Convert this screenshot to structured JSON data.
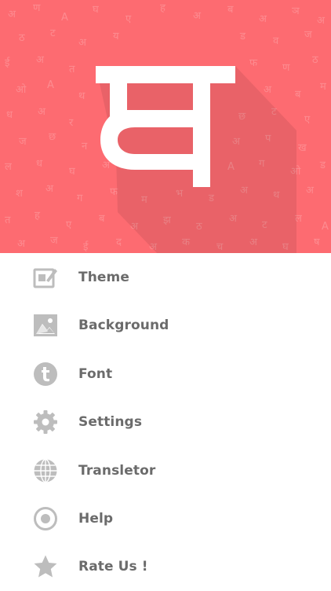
{
  "header": {
    "logo_glyph": "म",
    "background_color": "#fd6b71"
  },
  "menu": {
    "items": [
      {
        "label": "Theme",
        "icon": "theme-icon"
      },
      {
        "label": "Background",
        "icon": "image-icon"
      },
      {
        "label": "Font",
        "icon": "font-t-icon"
      },
      {
        "label": "Settings",
        "icon": "gear-icon"
      },
      {
        "label": "Transletor",
        "icon": "globe-icon"
      },
      {
        "label": "Help",
        "icon": "help-circle-icon"
      },
      {
        "label": "Rate Us !",
        "icon": "star-icon"
      }
    ]
  },
  "colors": {
    "accent": "#fd6b71",
    "icon": "#bdbdbd",
    "label": "#6b6b6b"
  }
}
